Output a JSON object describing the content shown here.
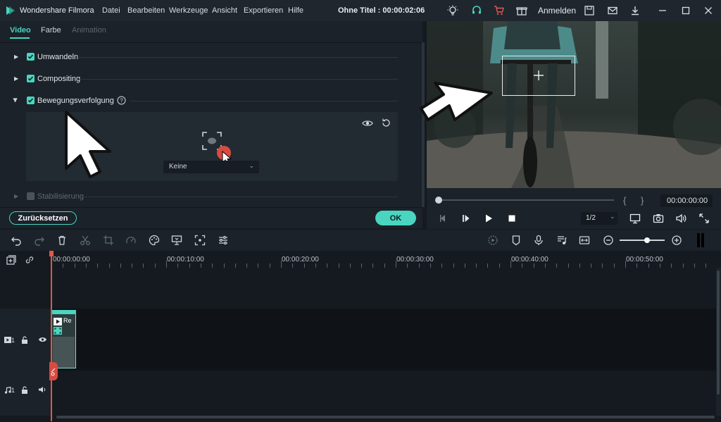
{
  "window": {
    "app_name": "Wondershare Filmora",
    "menu": [
      "Datei",
      "Bearbeiten",
      "Werkzeuge",
      "Ansicht",
      "Exportieren",
      "Hilfe"
    ],
    "title": "Ohne Titel : 00:00:02:06",
    "signin_label": "Anmelden"
  },
  "panel": {
    "tabs": [
      "Video",
      "Farbe",
      "Animation"
    ],
    "sections": [
      {
        "label": "Umwandeln"
      },
      {
        "label": "Compositing"
      },
      {
        "label": "Bewegungsverfolgung"
      },
      {
        "label": "Stabilisierung"
      }
    ],
    "tracking_select_value": "Keine",
    "reset_label": "Zurücksetzen",
    "ok_label": "OK"
  },
  "preview": {
    "timecode": "00:00:00:00",
    "ratio": "1/2",
    "bracket_left": "{",
    "bracket_right": "}"
  },
  "timeline": {
    "ruler": [
      "00:00:00:00",
      "00:00:10:00",
      "00:00:20:00",
      "00:00:30:00",
      "00:00:40:00",
      "00:00:50:00"
    ],
    "video_track_label": "1",
    "audio_track_label": "1",
    "clip_label": "Re"
  },
  "colors": {
    "accent": "#49d5c0",
    "playhead": "#e0574c",
    "cart": "#e35a4f"
  }
}
